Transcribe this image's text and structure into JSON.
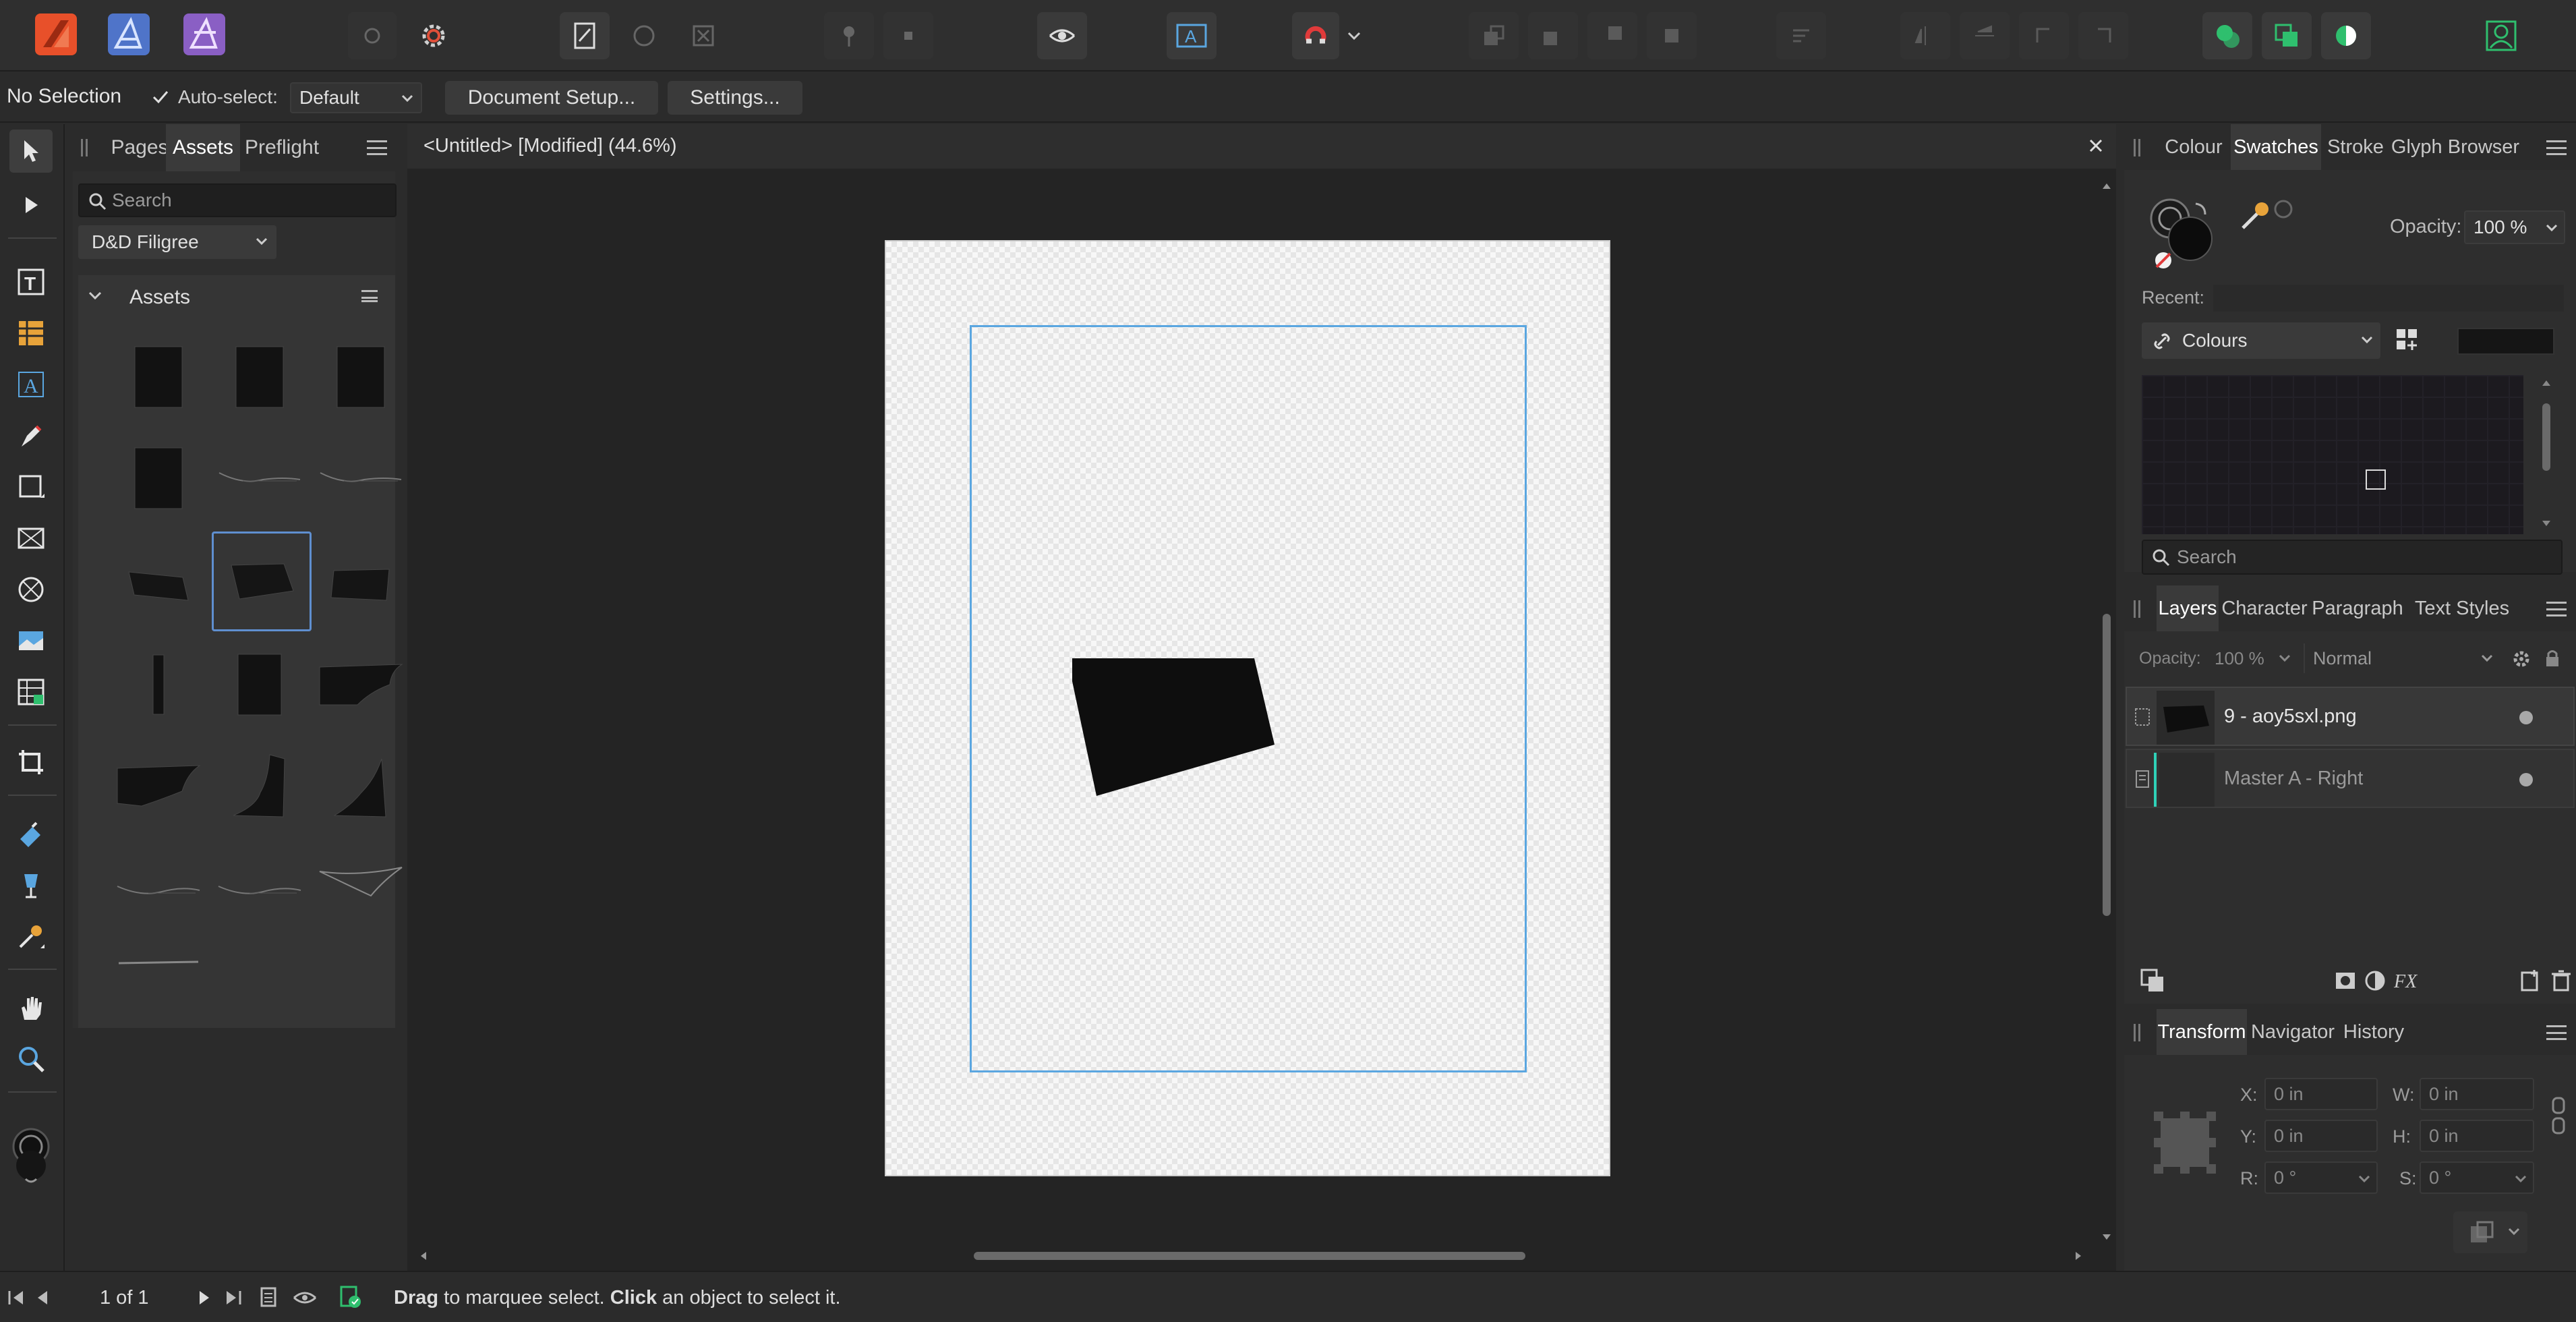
{
  "toolbar": {
    "personas": [
      "publisher-persona",
      "designer-persona",
      "photo-persona"
    ],
    "accent_publisher": "#e8502a",
    "accent_designer": "#4f74c9",
    "accent_photo": "#8a5fc4"
  },
  "context": {
    "selection_status": "No Selection",
    "auto_select_label": "Auto-select:",
    "auto_select_checked": true,
    "auto_select_value": "Default",
    "document_setup_label": "Document Setup...",
    "settings_label": "Settings..."
  },
  "assets_panel": {
    "tabs": [
      "Pages",
      "Assets",
      "Preflight"
    ],
    "active_tab": "Assets",
    "search_placeholder": "Search",
    "category": "D&D Filigree",
    "group_title": "Assets"
  },
  "document": {
    "title": "<Untitled> [Modified] (44.6%)",
    "guide_color": "#5aa6e0"
  },
  "swatches_panel": {
    "tabs": [
      "Colour",
      "Swatches",
      "Stroke",
      "Glyph Browser"
    ],
    "active_tab": "Swatches",
    "opacity_label": "Opacity:",
    "opacity_value": "100 %",
    "recent_label": "Recent:",
    "palette": "Colours",
    "search_placeholder": "Search"
  },
  "layers_panel": {
    "tabs": [
      "Layers",
      "Character",
      "Paragraph",
      "Text Styles"
    ],
    "active_tab": "Layers",
    "opacity_label": "Opacity:",
    "opacity_value": "100 %",
    "blend_mode": "Normal",
    "layers": [
      {
        "name": "9 - aoy5sxl.png",
        "dim": false
      },
      {
        "name": "Master A - Right",
        "dim": true
      }
    ]
  },
  "transform_panel": {
    "tabs": [
      "Transform",
      "Navigator",
      "History"
    ],
    "active_tab": "Transform",
    "fields": {
      "x_label": "X:",
      "x_value": "0 in",
      "y_label": "Y:",
      "y_value": "0 in",
      "w_label": "W:",
      "w_value": "0 in",
      "h_label": "H:",
      "h_value": "0 in",
      "r_label": "R:",
      "r_value": "0 °",
      "s_label": "S:",
      "s_value": "0 °"
    }
  },
  "status": {
    "page_indicator": "1 of 1",
    "hint_drag": "Drag",
    "hint_drag_text": " to marquee select. ",
    "hint_click": "Click",
    "hint_click_text": " an object to select it."
  }
}
